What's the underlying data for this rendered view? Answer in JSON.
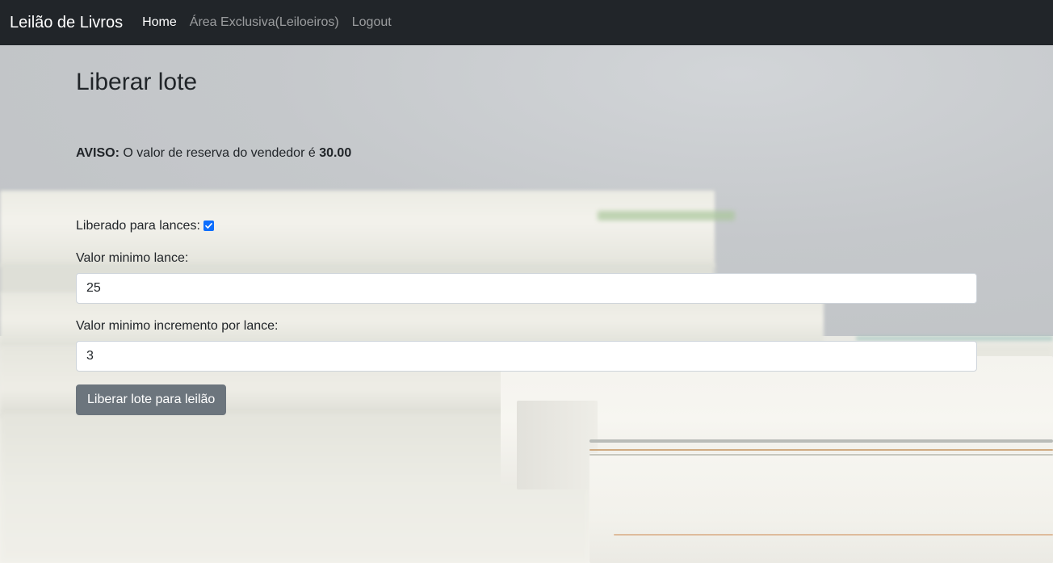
{
  "navbar": {
    "brand": "Leilão de Livros",
    "links": [
      {
        "label": "Home",
        "active": true
      },
      {
        "label": "Área Exclusiva(Leiloeiros)",
        "active": false
      },
      {
        "label": "Logout",
        "active": false
      }
    ]
  },
  "page": {
    "title": "Liberar lote",
    "notice_prefix": "AVISO:",
    "notice_text": " O valor de reserva do vendedor é ",
    "notice_value": "30.00"
  },
  "form": {
    "released_label": "Liberado para lances:",
    "released_checked": true,
    "min_bid_label": "Valor minimo lance:",
    "min_bid_value": "25",
    "min_increment_label": "Valor minimo incremento por lance:",
    "min_increment_value": "3",
    "submit_label": "Liberar lote para leilão"
  },
  "colors": {
    "navbar_bg": "#212529",
    "button_bg": "#6c757d",
    "checkbox_accent": "#0d6efd"
  },
  "icons": {
    "checkbox": "checkmark-icon"
  }
}
